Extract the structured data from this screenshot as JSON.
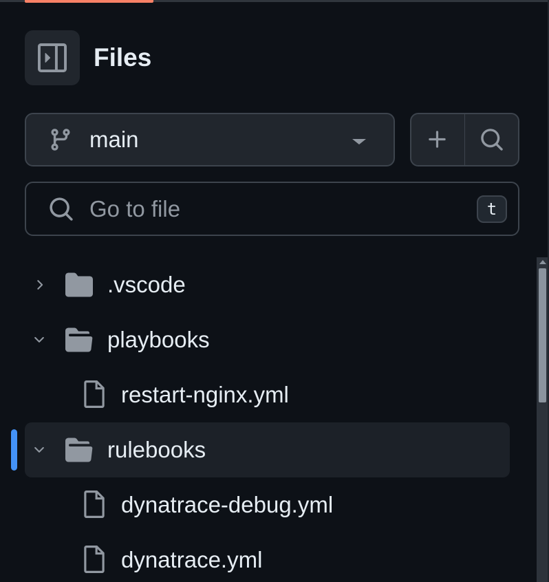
{
  "colors": {
    "background": "#0d1117",
    "accent_tab": "#f78166",
    "selection_indicator": "#4493f8",
    "icon_gray": "#9198a1"
  },
  "header": {
    "title": "Files",
    "collapse_icon": "sidebar-collapse-icon"
  },
  "branch": {
    "label": "main",
    "icon": "git-branch-icon"
  },
  "actions": {
    "add_icon": "plus-icon",
    "search_icon": "search-icon"
  },
  "goto": {
    "placeholder": "Go to file",
    "shortcut": "t"
  },
  "tree": [
    {
      "name": ".vscode",
      "type": "folder",
      "expanded": false
    },
    {
      "name": "playbooks",
      "type": "folder",
      "expanded": true
    },
    {
      "name": "restart-nginx.yml",
      "type": "file"
    },
    {
      "name": "rulebooks",
      "type": "folder",
      "expanded": true,
      "selected": true
    },
    {
      "name": "dynatrace-debug.yml",
      "type": "file"
    },
    {
      "name": "dynatrace.yml",
      "type": "file"
    }
  ]
}
